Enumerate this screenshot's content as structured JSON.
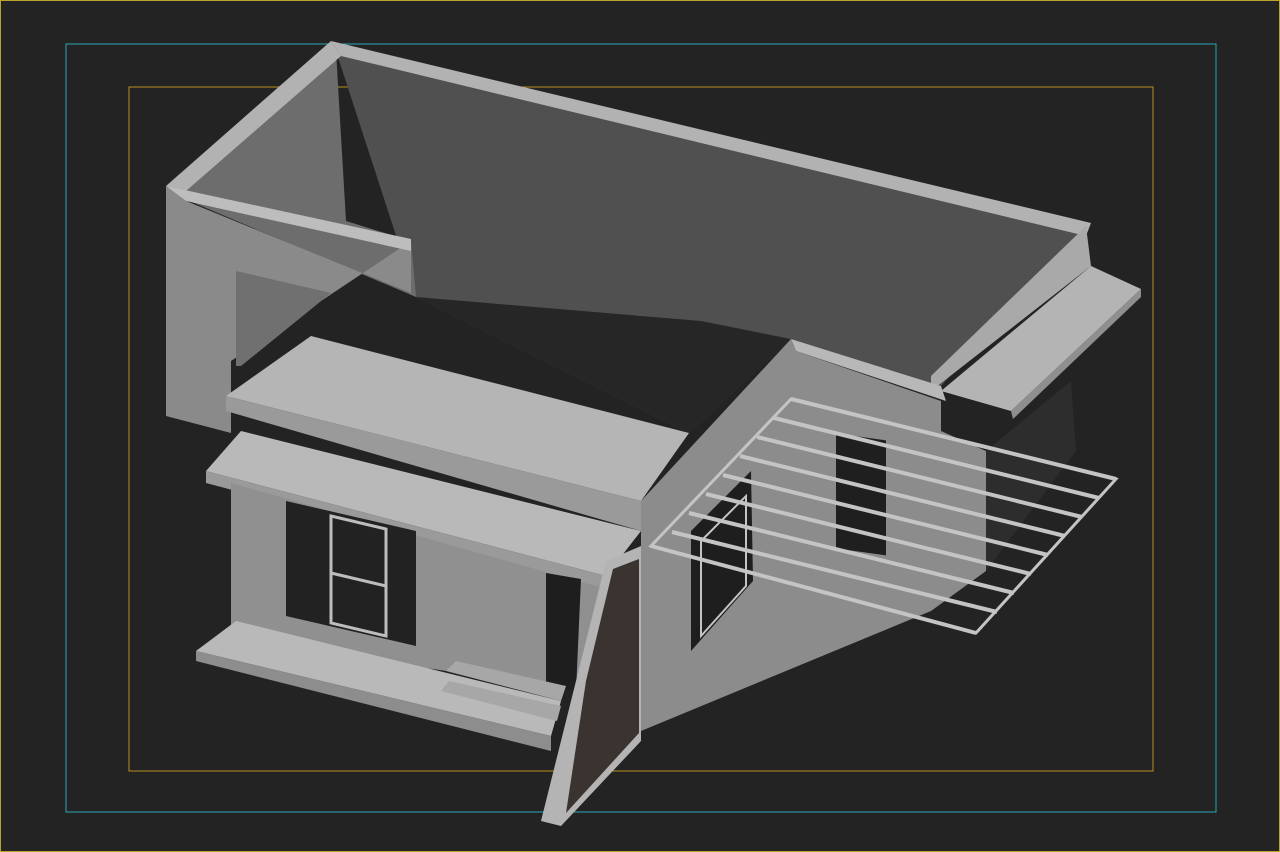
{
  "viewport": {
    "background_color": "#232323",
    "outer_border_color": "#b8a42a",
    "safe_frame_color": "#2aa7b8",
    "render_frame_color": "#b8901f"
  },
  "model": {
    "description_hint": "",
    "wall_light": "#bcbcbc",
    "wall_mid": "#8a8a8a",
    "wall_dark": "#6d6d6d",
    "floor_dark": "#2b2b2b",
    "glass_dark": "#1d1d1d"
  }
}
